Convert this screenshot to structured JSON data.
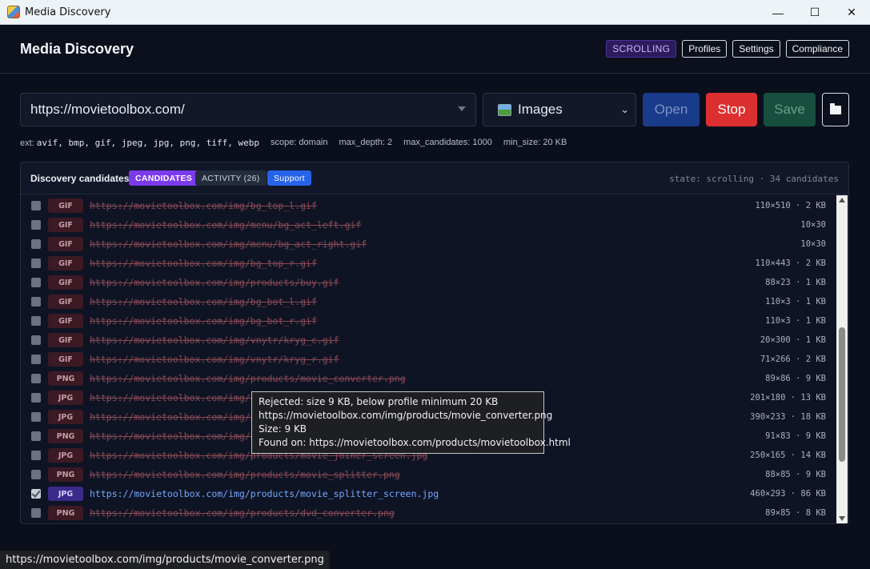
{
  "window": {
    "title": "Media Discovery",
    "minimize": "—",
    "maximize": "☐",
    "close": "✕"
  },
  "header": {
    "title": "Media Discovery",
    "state_badge": "SCROLLING",
    "buttons": [
      "Profiles",
      "Settings",
      "Compliance"
    ]
  },
  "toolbar": {
    "url": "https://movietoolbox.com/",
    "media_type": "Images",
    "open_label": "Open",
    "stop_label": "Stop",
    "save_label": "Save",
    "folder_icon": "folder-icon"
  },
  "meta": {
    "ext_label": "ext:",
    "ext_value": "avif, bmp, gif, jpeg, jpg, png, tiff, webp",
    "scope": "scope: domain",
    "max_depth": "max_depth: 2",
    "max_candidates": "max_candidates: 1000",
    "min_size": "min_size: 20 KB"
  },
  "panel": {
    "title": "Discovery candidates",
    "tab_candidates": "CANDIDATES",
    "tab_activity": "ACTIVITY (26)",
    "tab_support": "Support",
    "state_text": "state: scrolling · 34 candidates"
  },
  "rows": [
    {
      "fmt": "GIF",
      "url": "https://movietoolbox.com/img/bg_top_l.gif",
      "dims": "110×510 · 2 KB",
      "checked": false,
      "ok": false
    },
    {
      "fmt": "GIF",
      "url": "https://movietoolbox.com/img/menu/bg_act_left.gif",
      "dims": "10×30",
      "checked": false,
      "ok": false
    },
    {
      "fmt": "GIF",
      "url": "https://movietoolbox.com/img/menu/bg_act_right.gif",
      "dims": "10×30",
      "checked": false,
      "ok": false
    },
    {
      "fmt": "GIF",
      "url": "https://movietoolbox.com/img/bg_top_r.gif",
      "dims": "110×443 · 2 KB",
      "checked": false,
      "ok": false
    },
    {
      "fmt": "GIF",
      "url": "https://movietoolbox.com/img/products/buy.gif",
      "dims": "88×23 · 1 KB",
      "checked": false,
      "ok": false
    },
    {
      "fmt": "GIF",
      "url": "https://movietoolbox.com/img/bg_bot_l.gif",
      "dims": "110×3 · 1 KB",
      "checked": false,
      "ok": false
    },
    {
      "fmt": "GIF",
      "url": "https://movietoolbox.com/img/bg_bot_r.gif",
      "dims": "110×3 · 1 KB",
      "checked": false,
      "ok": false
    },
    {
      "fmt": "GIF",
      "url": "https://movietoolbox.com/img/vnytr/kryg_c.gif",
      "dims": "20×300 · 1 KB",
      "checked": false,
      "ok": false
    },
    {
      "fmt": "GIF",
      "url": "https://movietoolbox.com/img/vnytr/kryg_r.gif",
      "dims": "71×266 · 2 KB",
      "checked": false,
      "ok": false
    },
    {
      "fmt": "PNG",
      "url": "https://movietoolbox.com/img/products/movie_converter.png",
      "dims": "89×86 · 9 KB",
      "checked": false,
      "ok": false
    },
    {
      "fmt": "JPG",
      "url": "https://movietoolbox.com/img/pr",
      "dims": "201×180 · 13 KB",
      "checked": false,
      "ok": false
    },
    {
      "fmt": "JPG",
      "url": "https://movietoolbox.com/img/pr",
      "dims": "390×233 · 18 KB",
      "checked": false,
      "ok": false
    },
    {
      "fmt": "PNG",
      "url": "https://movietoolbox.com/img/pr",
      "dims": "91×83 · 9 KB",
      "checked": false,
      "ok": false
    },
    {
      "fmt": "JPG",
      "url": "https://movietoolbox.com/img/products/movie_joiner_screen.jpg",
      "dims": "250×165 · 14 KB",
      "checked": false,
      "ok": false
    },
    {
      "fmt": "PNG",
      "url": "https://movietoolbox.com/img/products/movie_splitter.png",
      "dims": "88×85 · 9 KB",
      "checked": false,
      "ok": false
    },
    {
      "fmt": "JPG",
      "url": "https://movietoolbox.com/img/products/movie_splitter_screen.jpg",
      "dims": "460×293 · 86 KB",
      "checked": true,
      "ok": true
    },
    {
      "fmt": "PNG",
      "url": "https://movietoolbox.com/img/products/dvd_converter.png",
      "dims": "89×85 · 8 KB",
      "checked": false,
      "ok": false
    }
  ],
  "tooltip": {
    "line1": "Rejected: size 9 KB, below profile minimum 20 KB",
    "line2": "https://movietoolbox.com/img/products/movie_converter.png",
    "line3": "Size: 9 KB",
    "line4": "Found on: https://movietoolbox.com/products/movietoolbox.html"
  },
  "statusbar": {
    "url": "https://movietoolbox.com/img/products/movie_converter.png"
  }
}
